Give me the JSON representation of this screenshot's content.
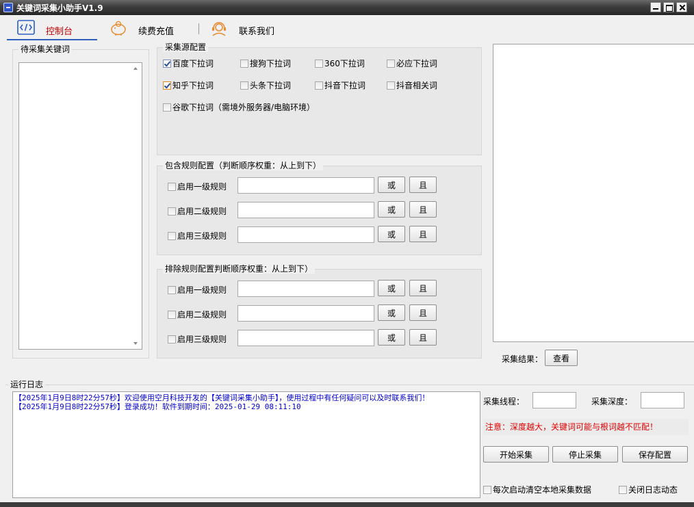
{
  "window": {
    "title": "关键词采集小助手V1.9"
  },
  "nav": {
    "console": "控制台",
    "recharge": "续费充值",
    "contact": "联系我们"
  },
  "keywords_panel": {
    "title": "待采集关键词"
  },
  "sources": {
    "title": "采集源配置",
    "items": [
      {
        "label": "百度下拉词",
        "checked": true
      },
      {
        "label": "搜狗下拉词",
        "checked": false
      },
      {
        "label": "360下拉词",
        "checked": false
      },
      {
        "label": "必应下拉词",
        "checked": false
      },
      {
        "label": "知乎下拉词",
        "checked": true
      },
      {
        "label": "头条下拉词",
        "checked": false
      },
      {
        "label": "抖音下拉词",
        "checked": false
      },
      {
        "label": "抖音相关词",
        "checked": false
      },
      {
        "label": "谷歌下拉词（需境外服务器/电脑环境）",
        "checked": false
      }
    ]
  },
  "include_rules": {
    "title": "包含规则配置（判断顺序权重：从上到下）",
    "rows": [
      {
        "label": "启用一级规则",
        "value": "",
        "or": "或",
        "and": "且"
      },
      {
        "label": "启用二级规则",
        "value": "",
        "or": "或",
        "and": "且"
      },
      {
        "label": "启用三级规则",
        "value": "",
        "or": "或",
        "and": "且"
      }
    ]
  },
  "exclude_rules": {
    "title": "排除规则配置判断顺序权重：从上到下）",
    "rows": [
      {
        "label": "启用一级规则",
        "value": "",
        "or": "或",
        "and": "且"
      },
      {
        "label": "启用二级规则",
        "value": "",
        "or": "或",
        "and": "且"
      },
      {
        "label": "启用三级规则",
        "value": "",
        "or": "或",
        "and": "且"
      }
    ]
  },
  "results": {
    "label": "采集结果：",
    "view_button": "查看"
  },
  "log": {
    "title": "运行日志",
    "lines": [
      "【2025年1月9日8时22分57秒】欢迎使用空月科技开发的【关键词采集小助手】，使用过程中有任何疑问可以及时联系我们！",
      "【2025年1月9日8时22分57秒】登录成功！软件到期时间：2025-01-29 08:11:10"
    ]
  },
  "controls": {
    "threads_label": "采集线程：",
    "threads_value": "",
    "depth_label": "采集深度：",
    "depth_value": "",
    "warning": "注意：深度越大，关键词可能与根词越不匹配！",
    "start_button": "开始采集",
    "stop_button": "停止采集",
    "save_button": "保存配置",
    "clear_on_start": "每次启动清空本地采集数据",
    "close_log": "关闭日志动态"
  },
  "colors": {
    "accent": "#2c5fbf",
    "active_tab": "#c00000",
    "log_text": "#0000cc",
    "warning": "#e00000"
  }
}
